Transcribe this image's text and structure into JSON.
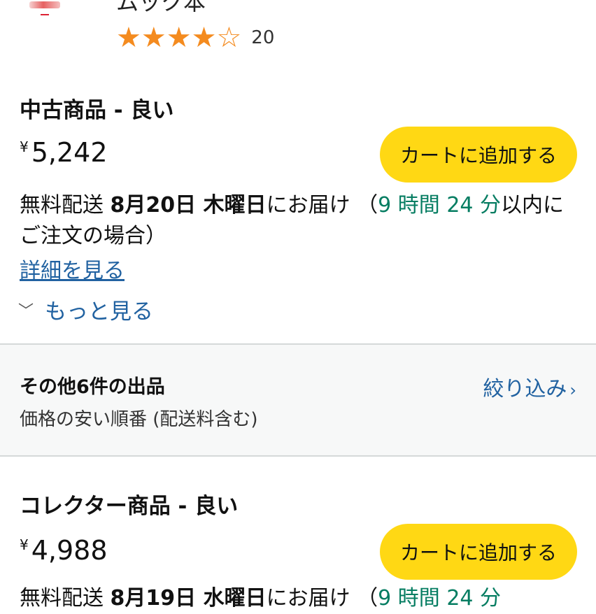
{
  "product": {
    "format_label": "ムック本",
    "rating_value": 4,
    "rating_max": 5,
    "rating_count": "20"
  },
  "offers": [
    {
      "condition": "中古商品 - 良い",
      "currency": "¥",
      "price": "5,242",
      "cart_label": "カートに追加する",
      "delivery_prefix": "無料配送 ",
      "delivery_date": "8月20日 木曜日",
      "delivery_suffix": "にお届け （",
      "countdown": "9 時間 24 分",
      "countdown_suffix": "以内にご注文の場合）"
    },
    {
      "condition": "コレクター商品 - 良い",
      "currency": "¥",
      "price": "4,988",
      "cart_label": "カートに追加する",
      "delivery_prefix": "無料配送 ",
      "delivery_date": "8月19日 水曜日",
      "delivery_suffix": "にお届け （",
      "countdown": "9 時間 24 分",
      "countdown_suffix": ""
    }
  ],
  "links": {
    "details": "詳細を見る",
    "more": "もっと見る"
  },
  "other_sellers": {
    "title": "その他6件の出品",
    "sort": "価格の安い順番 (配送料含む)",
    "filter": "絞り込み"
  },
  "colors": {
    "accent_button": "#ffd814",
    "star": "#f48b1f",
    "link": "#2162a1",
    "countdown": "#067d62"
  },
  "icons": [
    "star-filled-icon",
    "star-empty-icon",
    "chevron-down-icon",
    "chevron-right-icon"
  ]
}
